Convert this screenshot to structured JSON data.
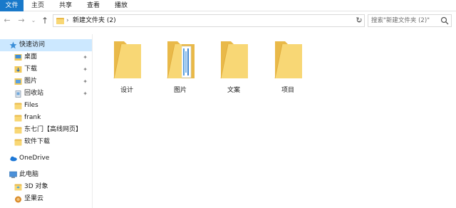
{
  "ribbon": {
    "tabs": [
      "文件",
      "主页",
      "共享",
      "查看",
      "播放"
    ]
  },
  "address": {
    "path": "新建文件夹 (2)",
    "separator": "›"
  },
  "search": {
    "placeholder": "搜索\"新建文件夹 (2)\""
  },
  "sidebar": {
    "quick_access": "快速访问",
    "items": [
      {
        "label": "桌面",
        "pinned": true,
        "icon": "desktop-icon"
      },
      {
        "label": "下载",
        "pinned": true,
        "icon": "download-icon"
      },
      {
        "label": "图片",
        "pinned": true,
        "icon": "pictures-icon"
      },
      {
        "label": "回收站",
        "pinned": true,
        "icon": "recycle-bin-icon"
      },
      {
        "label": "Files",
        "pinned": false,
        "icon": "folder-icon"
      },
      {
        "label": "frank",
        "pinned": false,
        "icon": "folder-icon"
      },
      {
        "label": "东七门【高线网页】",
        "pinned": false,
        "icon": "folder-icon"
      },
      {
        "label": "软件下载",
        "pinned": false,
        "icon": "folder-icon"
      }
    ],
    "onedrive": "OneDrive",
    "this_pc": "此电脑",
    "pc_items": [
      {
        "label": "3D 对象",
        "icon": "3d-objects-icon"
      },
      {
        "label": "坚果云",
        "icon": "jianguoyun-icon"
      }
    ]
  },
  "folders": [
    {
      "name": "设计",
      "has_content": false
    },
    {
      "name": "图片",
      "has_content": true
    },
    {
      "name": "文案",
      "has_content": false
    },
    {
      "name": "项目",
      "has_content": false
    }
  ],
  "colors": {
    "file_tab": "#1979ca",
    "selected": "#cce8ff",
    "folder_back": "#e9b949",
    "folder_front": "#f8d775"
  }
}
